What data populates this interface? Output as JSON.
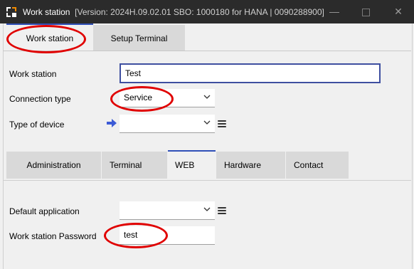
{
  "window": {
    "title": "Work station",
    "version_info": "[Version: 2024H.09.02.01 SBO: 1000180 for HANA | 0090288900]",
    "min_glyph": "—",
    "close_glyph": "✕"
  },
  "main_tabs": [
    {
      "label": "Work station",
      "active": true
    },
    {
      "label": "Setup Terminal",
      "active": false
    }
  ],
  "form": {
    "work_station": {
      "label": "Work station",
      "value": "Test"
    },
    "connection_type": {
      "label": "Connection type",
      "value": "Service"
    },
    "device_type": {
      "label": "Type of device",
      "value": ""
    }
  },
  "sub_tabs": [
    {
      "label": "Administration",
      "active": false
    },
    {
      "label": "Terminal",
      "active": false
    },
    {
      "label": "WEB",
      "active": true
    },
    {
      "label": "Hardware",
      "active": false
    },
    {
      "label": "Contact",
      "active": false
    }
  ],
  "web": {
    "default_application": {
      "label": "Default application",
      "value": ""
    },
    "password": {
      "label": "Work station Password",
      "value": "test"
    }
  },
  "icons": [
    "app-logo-icon",
    "minimize-icon",
    "maximize-icon",
    "close-icon",
    "chevron-down-icon",
    "list-icon",
    "arrow-right-icon"
  ],
  "colors": {
    "titlebar": "#2b2b2b",
    "annotation": "#e00000",
    "focus_border": "#3e4fa0",
    "arrow": "#3c5bd6"
  }
}
